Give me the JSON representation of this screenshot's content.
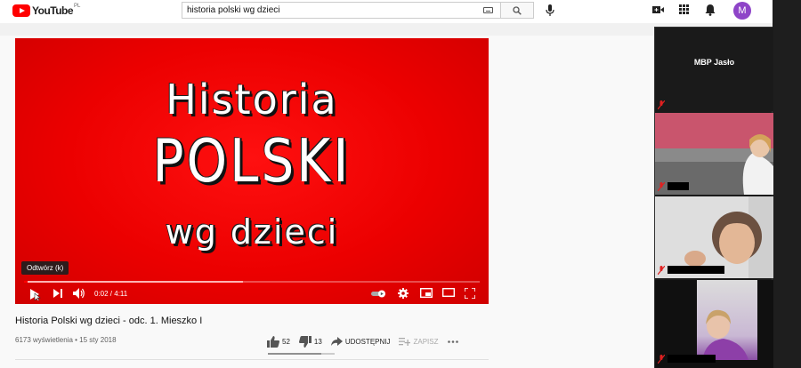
{
  "youtube": {
    "logo_text": "YouTube",
    "region": "PL",
    "search": {
      "value": "historia polski wg dzieci"
    },
    "avatar_letter": "M"
  },
  "video": {
    "thumbnail": {
      "line1": "Historia",
      "line2": "POLSKI",
      "line3": "wg dzieci"
    },
    "tooltip": "Odtwórz (k)",
    "time": "0:02 / 4:11",
    "progress": 0.008,
    "buffered": 0.48,
    "title": "Historia Polski wg dzieci - odc. 1. Mieszko I",
    "meta": "6173 wyświetlenia • 15 sty 2018",
    "likes": "52",
    "dislikes": "13",
    "share_label": "UDOSTĘPNIJ",
    "save_label": "ZAPISZ",
    "like_ratio": 0.8
  },
  "meeting": {
    "host_name": "MBP Jasło"
  },
  "colors": {
    "youtube_red": "#ff0000",
    "avatar": "#8e44c8",
    "panel_bg": "#1a1a1a",
    "mute_red": "#e02020"
  }
}
